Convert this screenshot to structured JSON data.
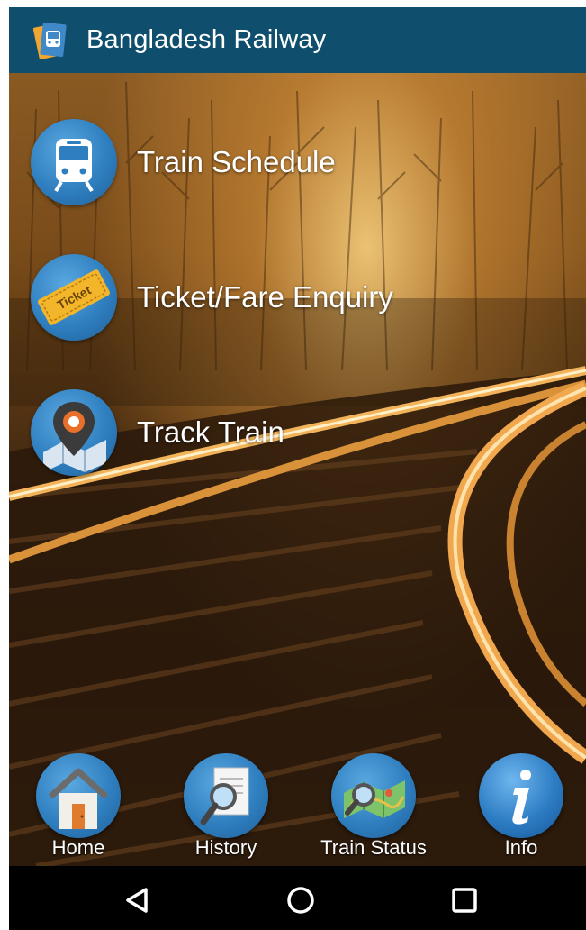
{
  "app": {
    "title": "Bangladesh Railway",
    "logo_icon": "railway-logo-icon",
    "bar_color": "#0f4f6d"
  },
  "menu": {
    "items": [
      {
        "label": "Train Schedule",
        "icon": "train-icon"
      },
      {
        "label": "Ticket/Fare Enquiry",
        "icon": "ticket-icon",
        "icon_text": "Ticket"
      },
      {
        "label": "Track Train",
        "icon": "map-pin-icon"
      }
    ]
  },
  "bottom_nav": {
    "items": [
      {
        "label": "Home",
        "icon": "home-icon"
      },
      {
        "label": "History",
        "icon": "history-search-icon"
      },
      {
        "label": "Train Status",
        "icon": "map-search-icon"
      },
      {
        "label": "Info",
        "icon": "info-icon"
      }
    ]
  },
  "system_nav": {
    "buttons": [
      "back-icon",
      "home-circle-icon",
      "recents-icon"
    ]
  }
}
